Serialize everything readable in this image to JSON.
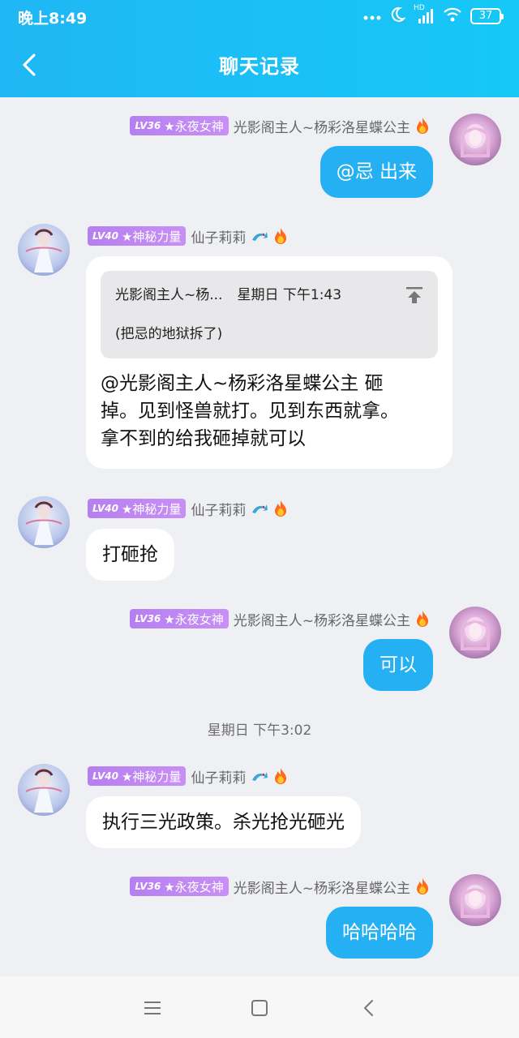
{
  "status_bar": {
    "time": "晚上8:49",
    "network_label": "HD",
    "battery": "37"
  },
  "header": {
    "title": "聊天记录"
  },
  "badges": {
    "lv36": "LV36",
    "lv36_title": "★永夜女神",
    "lv40": "LV40",
    "lv40_title": "★神秘力量"
  },
  "names": {
    "me": "光影阁主人~杨彩洛星蝶公主",
    "other": "仙子莉莉"
  },
  "messages": [
    {
      "sender": "me",
      "text": "@忌 出来"
    },
    {
      "sender": "other",
      "quote": {
        "author": "光影阁主人~杨...",
        "time": "星期日 下午1:43",
        "text": "(把忌的地狱拆了)"
      },
      "lines": [
        "@光影阁主人~杨彩洛星蝶公主 砸",
        "掉。见到怪兽就打。见到东西就拿。",
        "拿不到的给我砸掉就可以"
      ]
    },
    {
      "sender": "other",
      "text": "打砸抢"
    },
    {
      "sender": "me",
      "text": "可以"
    },
    {
      "sender": "other",
      "text": "执行三光政策。杀光抢光砸光"
    },
    {
      "sender": "me",
      "text": "哈哈哈哈"
    }
  ],
  "divider_time": "星期日 下午3:02",
  "colors": {
    "header": "#1fb7f5",
    "my_bubble": "#24b0f3",
    "badge": "#b57ff0"
  }
}
